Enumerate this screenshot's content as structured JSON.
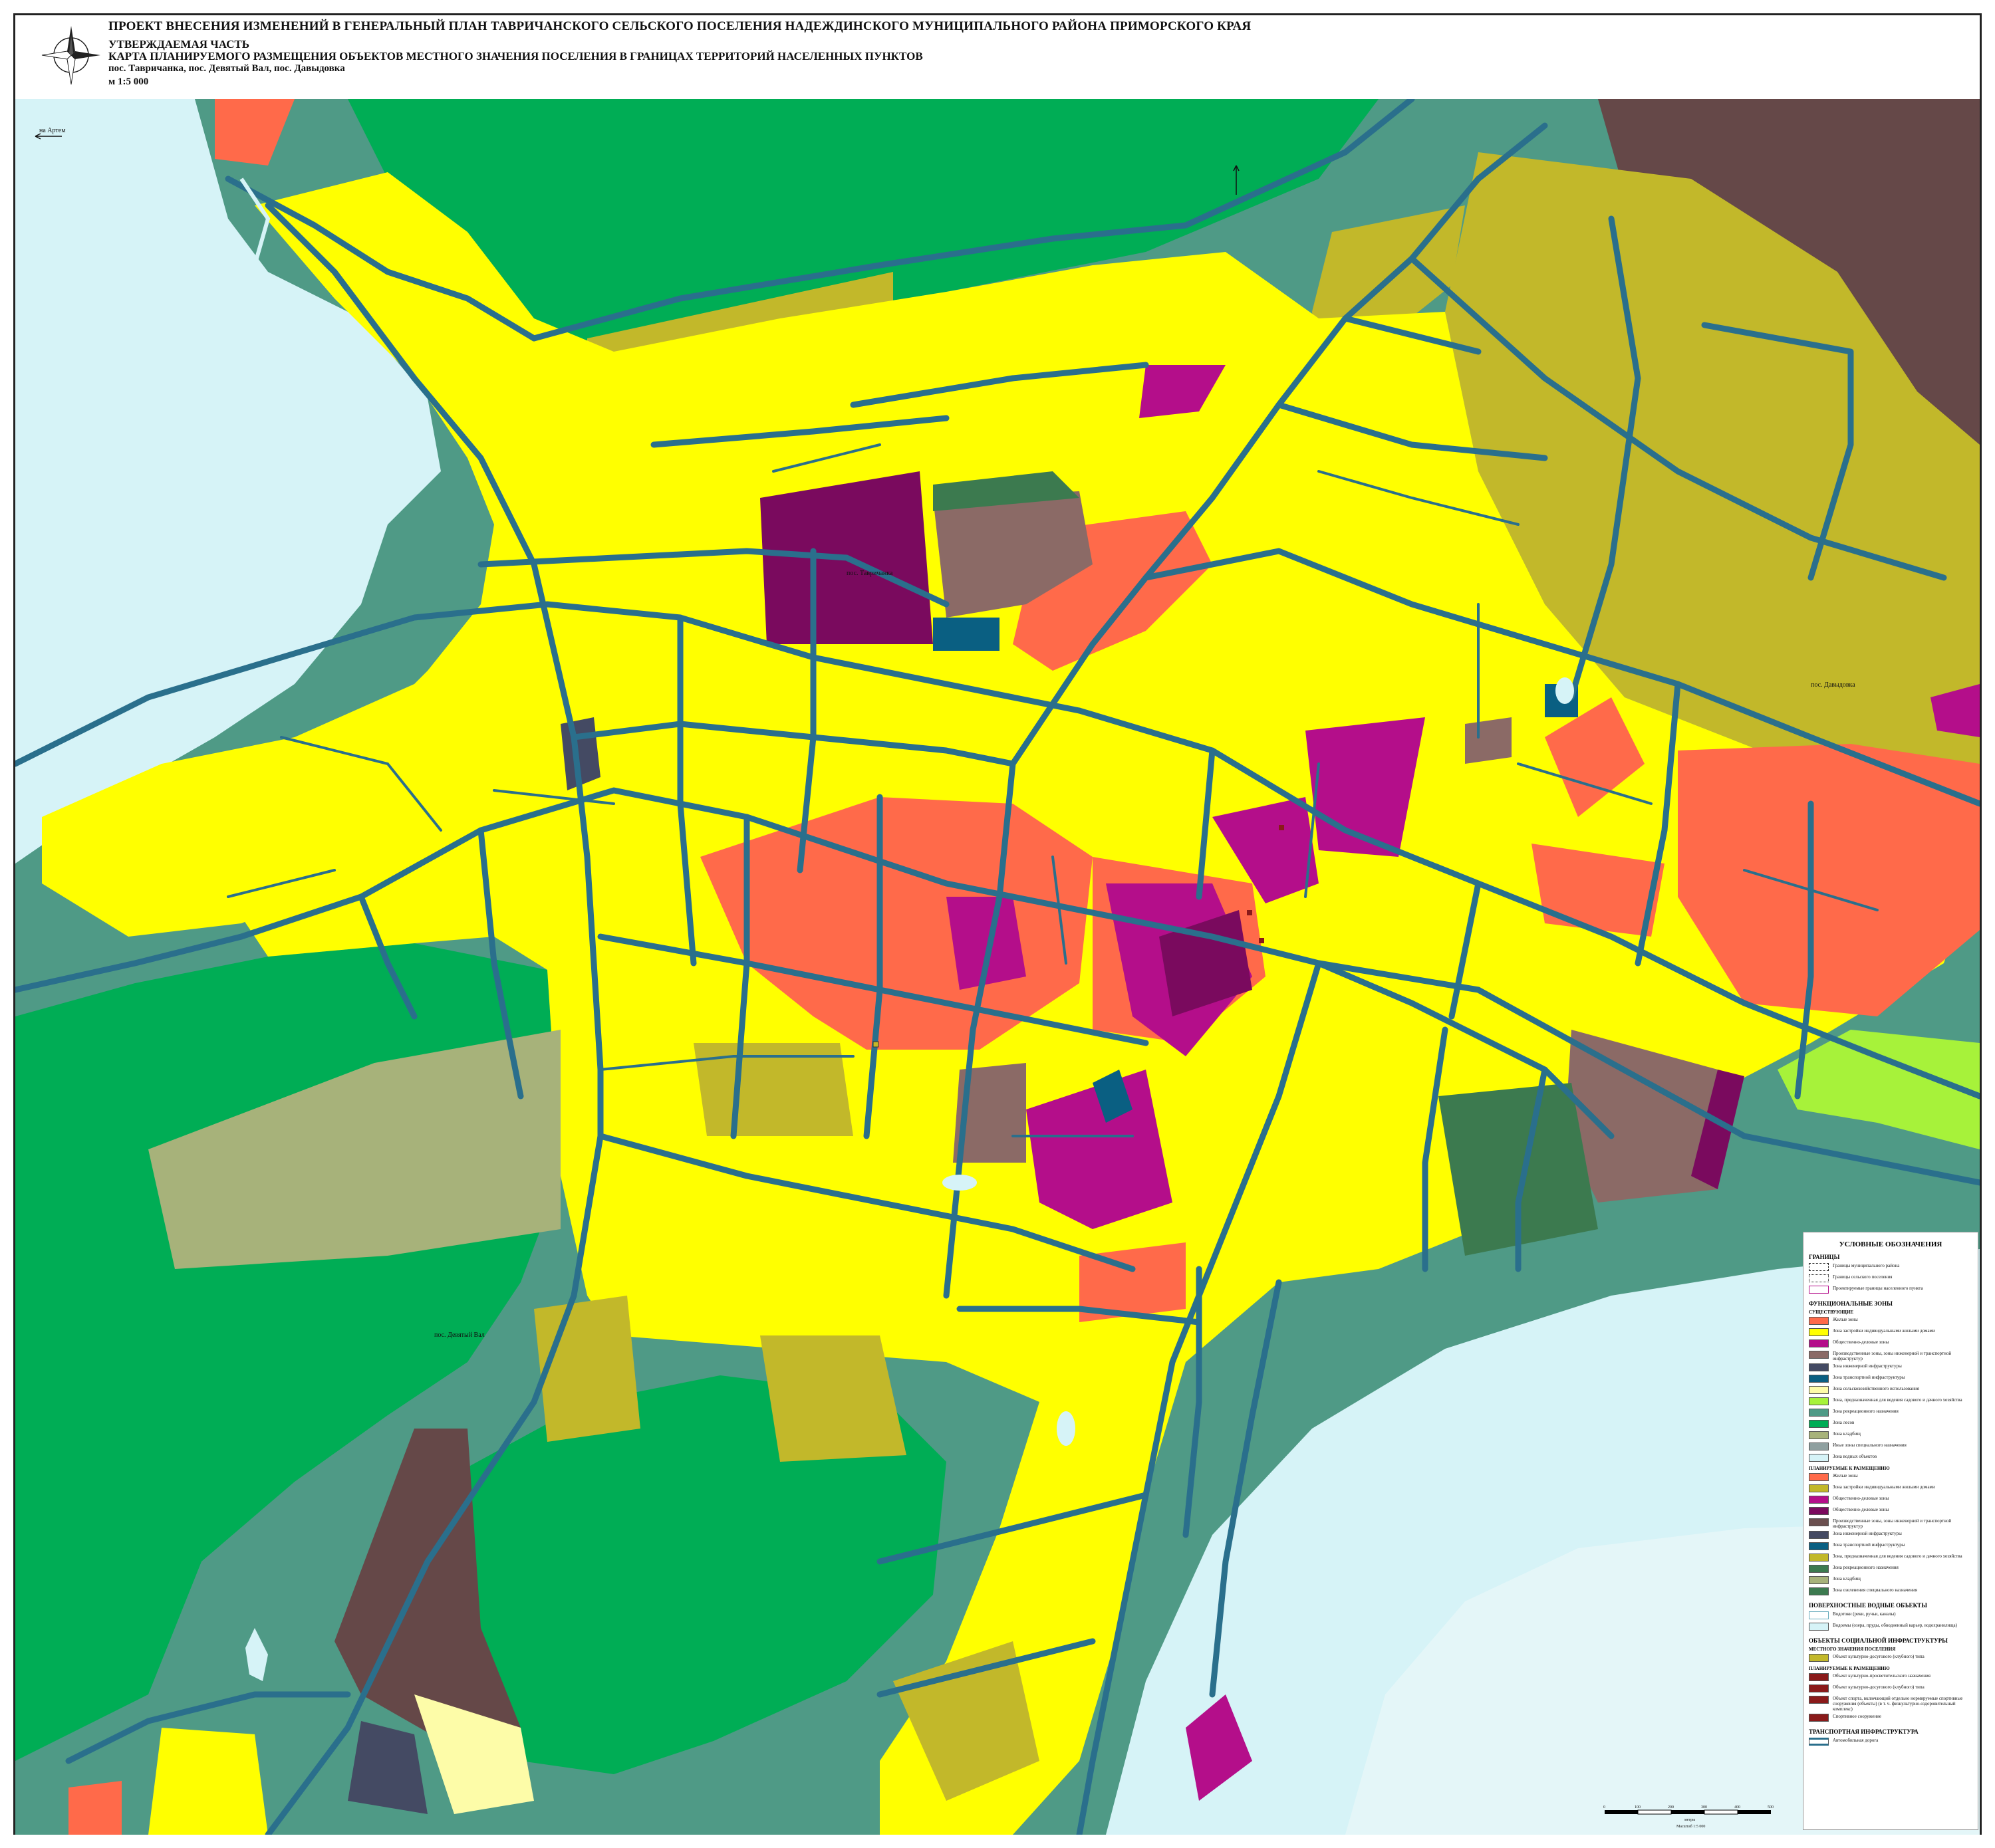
{
  "header": {
    "title": "ПРОЕКТ ВНЕСЕНИЯ ИЗМЕНЕНИЙ В ГЕНЕРАЛЬНЫЙ ПЛАН ТАВРИЧАНСКОГО СЕЛЬСКОГО ПОСЕЛЕНИЯ НАДЕЖДИНСКОГО МУНИЦИПАЛЬНОГО РАЙОНА ПРИМОРСКОГО КРАЯ",
    "part": "УТВЕРЖДАЕМАЯ ЧАСТЬ",
    "map_title": "КАРТА ПЛАНИРУЕМОГО РАЗМЕЩЕНИЯ ОБЪЕКТОВ МЕСТНОГО ЗНАЧЕНИЯ ПОСЕЛЕНИЯ В ГРАНИЦАХ ТЕРРИТОРИЙ НАСЕЛЕННЫХ ПУНКТОВ",
    "settlements": "пос. Тавричанка, пос. Девятый Вал, пос. Давыдовка",
    "scale": "м 1:5 000"
  },
  "map_labels": {
    "tavrichanka": "пос. Тавричанка",
    "davydovka": "пос. Давыдовка",
    "devyatyi_val": "пос. Девятый Вал",
    "to_artem": "на Артем"
  },
  "colors": {
    "water": "#d6f3f7",
    "forest": "#00ad55",
    "green_zone": "#4f9a86",
    "residential": "#ffff00",
    "garden": "#c2b82a",
    "business": "#b40e8a",
    "business_dark": "#7a0a5e",
    "multi_residential": "#ff6a4a",
    "industrial": "#8b6a66",
    "transport": "#0a5f82",
    "road": "#2a6f8c",
    "dark_green": "#3c7a4f",
    "light_green": "#a7f23a",
    "cemetery": "#a7b27a",
    "recreation": "#fdfca8",
    "engineering": "#444a63"
  },
  "legend": {
    "title": "УСЛОВНЫЕ ОБОЗНАЧЕНИЯ",
    "borders_title": "ГРАНИЦЫ",
    "borders": [
      "Границы муниципального района",
      "Границы сельского поселения",
      "Проектируемые границы населенного пункта"
    ],
    "zones_title": "ФУНКЦИОНАЛЬНЫЕ ЗОНЫ",
    "existing_title": "СУЩЕСТВУЮЩИЕ",
    "existing": [
      {
        "label": "Жилые зоны",
        "color": "#ff6a4a"
      },
      {
        "label": "Зона застройки индивидуальными жилыми домами",
        "color": "#ffff00"
      },
      {
        "label": "Общественно-деловые зоны",
        "color": "#b40e8a"
      },
      {
        "label": "Производственные зоны, зоны инженерной и транспортной инфраструктур",
        "color": "#8b6a66"
      },
      {
        "label": "Зона инженерной инфраструктуры",
        "color": "#444a63"
      },
      {
        "label": "Зона транспортной инфраструктуры",
        "color": "#0a5f82"
      },
      {
        "label": "Зона сельскохозяйственного использования",
        "color": "#fdfca8"
      },
      {
        "label": "Зона, предназначенная для ведения садового и дачного хозяйства",
        "color": "#a7f23a"
      },
      {
        "label": "Зона рекреационного назначения",
        "color": "#4f9a86"
      },
      {
        "label": "Зона лесов",
        "color": "#00ad55"
      },
      {
        "label": "Зона кладбищ",
        "color": "#a7b27a"
      },
      {
        "label": "Иные зоны специального назначения",
        "color": "#8fa0a0"
      },
      {
        "label": "Зона водных объектов",
        "color": "#d6f3f7"
      }
    ],
    "planned_title": "ПЛАНИРУЕМЫЕ К РАЗМЕЩЕНИЮ",
    "planned": [
      {
        "label": "Жилые зоны",
        "color": "#ff6a4a"
      },
      {
        "label": "Зона застройки индивидуальными жилыми домами",
        "color": "#c2b82a"
      },
      {
        "label": "Общественно-деловые зоны",
        "color": "#b40e8a"
      },
      {
        "label": "Общественно-деловые зоны",
        "color": "#7a0a5e"
      },
      {
        "label": "Производственные зоны, зоны инженерной и транспортной инфраструктур",
        "color": "#6b4f4f"
      },
      {
        "label": "Зона инженерной инфраструктуры",
        "color": "#444a63"
      },
      {
        "label": "Зона транспортной инфраструктуры",
        "color": "#0a5f82"
      },
      {
        "label": "Зона, предназначенная для ведения садового и дачного хозяйства",
        "color": "#c2b82a"
      },
      {
        "label": "Зона рекреационного назначения",
        "color": "#3c7a4f"
      },
      {
        "label": "Зона кладбищ",
        "color": "#a7b27a"
      },
      {
        "label": "Зона озеленения специального назначения",
        "color": "#3c7a4f"
      }
    ],
    "water_title": "ПОВЕРХНОСТНЫЕ ВОДНЫЕ ОБЪЕКТЫ",
    "water": [
      "Водотоки (реки, ручьи, каналы)",
      "Водоемы (озера, пруды, обводненный карьер, водохранилища)"
    ],
    "social_title": "ОБЪЕКТЫ СОЦИАЛЬНОЙ ИНФРАСТРУКТУРЫ",
    "social_sub": "МЕСТНОГО ЗНАЧЕНИЯ ПОСЕЛЕНИЯ",
    "social_existing": "Объект культурно-досугового (клубного) типа",
    "social_planned_title": "ПЛАНИРУЕМЫЕ К РАЗМЕЩЕНИЮ",
    "social_planned": [
      "Объект культурно-просветительского назначения",
      "Объект культурно-досугового (клубного) типа",
      "Объект спорта, включающий отдельно нормируемые спортивные сооружения (объекты) (в т. ч. физкультурно-оздоровительный комплекс)",
      "Спортивное сооружение"
    ],
    "transport_title": "ТРАНСПОРТНАЯ ИНФРАСТРУКТУРА",
    "transport": "Автомобильная дорога"
  },
  "scalebar": {
    "ticks": [
      "0",
      "100",
      "200",
      "300",
      "400",
      "500"
    ],
    "unit": "метры",
    "scale": "Масштаб 1:5 000"
  }
}
